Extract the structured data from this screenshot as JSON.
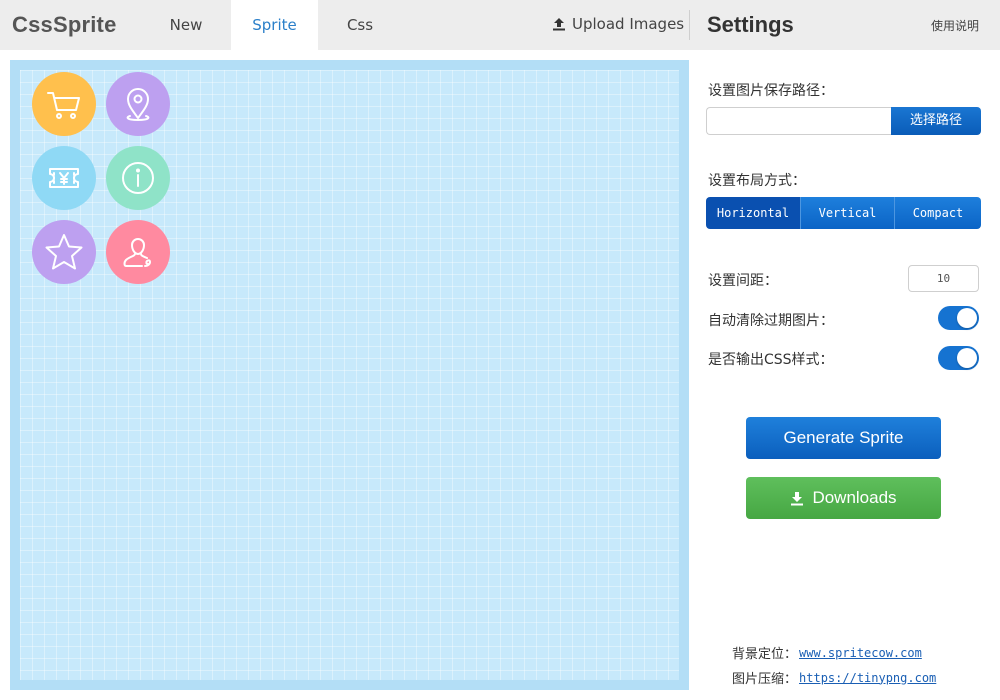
{
  "app": {
    "logo": "CssSprite"
  },
  "nav": {
    "tabs": [
      {
        "label": "New",
        "active": false
      },
      {
        "label": "Sprite",
        "active": true
      },
      {
        "label": "Css",
        "active": false
      }
    ],
    "upload_label": "Upload Images",
    "upload_icon": "upload-icon"
  },
  "settings": {
    "title": "Settings",
    "help_label": "使用说明",
    "save_path": {
      "label": "设置图片保存路径：",
      "value": "",
      "button_label": "选择路径"
    },
    "layout": {
      "label": "设置布局方式：",
      "options": [
        "Horizontal",
        "Vertical",
        "Compact"
      ],
      "selected": "Horizontal"
    },
    "spacing": {
      "label": "设置间距：",
      "value": "10"
    },
    "auto_clear": {
      "label": "自动清除过期图片：",
      "enabled": true
    },
    "output_css": {
      "label": "是否输出CSS样式：",
      "enabled": true
    },
    "generate_label": "Generate Sprite",
    "download_label": "Downloads",
    "footer": [
      {
        "label": "背景定位：",
        "link": "www.spritecow.com"
      },
      {
        "label": "图片压缩：",
        "link": "https://tinypng.com"
      }
    ]
  },
  "canvas": {
    "icons": [
      {
        "name": "cart-icon",
        "color": "#ffc04d"
      },
      {
        "name": "location-pin-icon",
        "color": "#bda0f0"
      },
      {
        "name": "ticket-yen-icon",
        "color": "#8fd9f5"
      },
      {
        "name": "info-icon",
        "color": "#8fe3c8"
      },
      {
        "name": "star-icon",
        "color": "#bda0f0"
      },
      {
        "name": "user-icon",
        "color": "#ff8aa0"
      }
    ]
  },
  "colors": {
    "accent": "#0b64c6",
    "success": "#4caf50",
    "canvas_bg": "#c7e9fb",
    "topbar_bg": "#ededed"
  }
}
